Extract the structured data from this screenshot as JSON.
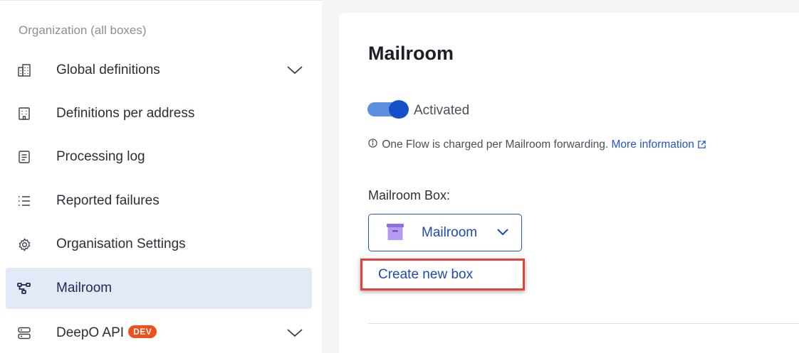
{
  "sidebar": {
    "heading": "Organization (all boxes)",
    "items": [
      {
        "label": "Global definitions",
        "icon": "building-grid-icon",
        "has_chevron": true
      },
      {
        "label": "Definitions per address",
        "icon": "building-icon",
        "has_chevron": false
      },
      {
        "label": "Processing log",
        "icon": "document-icon",
        "has_chevron": false
      },
      {
        "label": "Reported failures",
        "icon": "list-icon",
        "has_chevron": false
      },
      {
        "label": "Organisation Settings",
        "icon": "gear-icon",
        "has_chevron": false
      },
      {
        "label": "Mailroom",
        "icon": "flow-icon",
        "has_chevron": false,
        "active": true
      },
      {
        "label": "DeepO API",
        "icon": "server-icon",
        "has_chevron": true,
        "badge": "DEV"
      }
    ]
  },
  "main": {
    "title": "Mailroom",
    "toggle": {
      "label": "Activated",
      "on": true
    },
    "info": {
      "text": "One Flow is charged per Mailroom forwarding.",
      "link": "More information"
    },
    "box": {
      "label": "Mailroom Box:",
      "selected": "Mailroom"
    },
    "create_link": "Create new box"
  },
  "colors": {
    "accent": "#2456c9",
    "active_bg": "#e3e9f6",
    "badge": "#f04e1a",
    "highlight": "#e0433f",
    "box_icon": "#a98be8"
  }
}
